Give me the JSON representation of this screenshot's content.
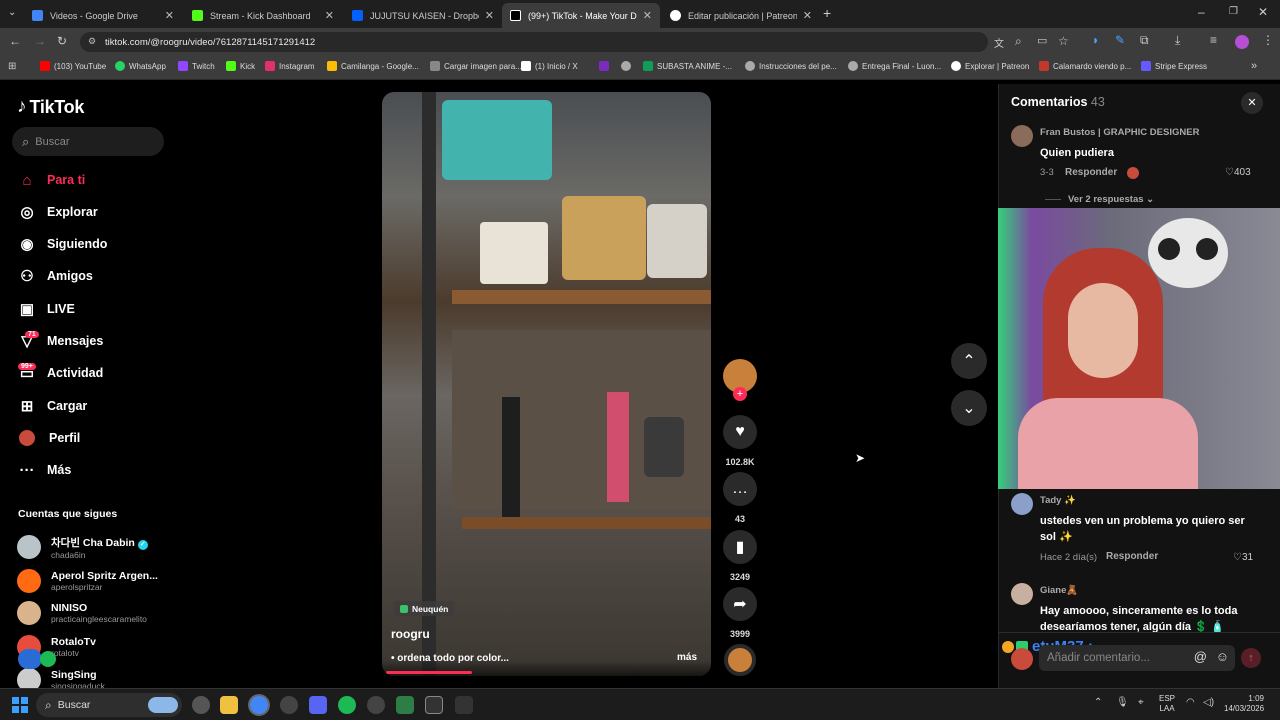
{
  "browser": {
    "tabs": [
      {
        "title": "Videos - Google Drive",
        "color": "#4285f4"
      },
      {
        "title": "Stream - Kick Dashboard",
        "color": "#53fc18"
      },
      {
        "title": "JUJUTSU KAISEN - Dropbox",
        "color": "#0061fe"
      },
      {
        "title": "(99+) TikTok - Make Your Da",
        "color": "#ffffff"
      },
      {
        "title": "Editar publicación | Patreon",
        "color": "#ffffff"
      }
    ],
    "url": "tiktok.com/@roogru/video/7612871145171291412",
    "bookmarks": [
      {
        "label": "(103) YouTube",
        "color": "#ff0000"
      },
      {
        "label": "WhatsApp",
        "color": "#25d366"
      },
      {
        "label": "Twitch",
        "color": "#9146ff"
      },
      {
        "label": "Kick",
        "color": "#53fc18"
      },
      {
        "label": "Instagram",
        "color": "#e1306c"
      },
      {
        "label": "Camilanga - Google...",
        "color": "#fbbc04"
      },
      {
        "label": "Cargar imagen para...",
        "color": "#888888"
      },
      {
        "label": "(1) Inicio / X",
        "color": "#ffffff"
      },
      {
        "label": "",
        "color": "#7b2cbf"
      },
      {
        "label": "",
        "color": "#aaaaaa"
      },
      {
        "label": "SUBASTA ANIME -...",
        "color": "#0f9d58"
      },
      {
        "label": "Instrucciones del pe...",
        "color": "#aaaaaa"
      },
      {
        "label": "Entrega Final - Luon...",
        "color": "#aaaaaa"
      },
      {
        "label": "Explorar | Patreon",
        "color": "#ffffff"
      },
      {
        "label": "Calamardo viendo p...",
        "color": "#c0392b"
      },
      {
        "label": "Stripe Express",
        "color": "#635bff"
      }
    ]
  },
  "tiktok": {
    "logo": "TikTok",
    "search_placeholder": "Buscar",
    "nav": [
      {
        "label": "Para ti",
        "icon": "home-icon"
      },
      {
        "label": "Explorar",
        "icon": "compass-icon"
      },
      {
        "label": "Siguiendo",
        "icon": "following-icon"
      },
      {
        "label": "Amigos",
        "icon": "friends-icon"
      },
      {
        "label": "LIVE",
        "icon": "live-icon"
      },
      {
        "label": "Mensajes",
        "icon": "messages-icon",
        "badge": "71"
      },
      {
        "label": "Actividad",
        "icon": "activity-icon",
        "badge": "99+"
      },
      {
        "label": "Cargar",
        "icon": "upload-icon"
      },
      {
        "label": "Perfil",
        "icon": "profile-icon"
      },
      {
        "label": "Más",
        "icon": "more-icon"
      }
    ],
    "following_title": "Cuentas que sigues",
    "following": [
      {
        "name": "차다빈 Cha Dabin",
        "handle": "chada6in",
        "verified": true,
        "color": "#b8c4c8"
      },
      {
        "name": "Aperol Spritz Argen...",
        "handle": "aperolspritzar",
        "color": "#ff6a13"
      },
      {
        "name": "NINISO",
        "handle": "practicaingleescaramelito",
        "color": "#d9b38c"
      },
      {
        "name": "RotaloTv",
        "handle": "rotalotv",
        "color": "#e74c3c"
      },
      {
        "name": "SingSing",
        "handle": "singsingaduck",
        "color": "#cccccc"
      }
    ]
  },
  "video": {
    "location": "Neuquén",
    "author": "roogru",
    "caption": "• ordena todo por color...",
    "more": "más",
    "likes": "102.8K",
    "comments": "43",
    "saves": "3249",
    "shares": "3999"
  },
  "comments_panel": {
    "title": "Comentarios",
    "count": "43",
    "items": [
      {
        "name": "Fran Bustos | GRAPHIC DESIGNER",
        "text": "Quien pudiera",
        "meta": "3-3",
        "reply": "Responder",
        "likes": "403",
        "replies": "Ver 2 respuestas"
      },
      {
        "name": "Tady ✨",
        "text": "ustedes ven un problema yo quiero ser sol ✨",
        "meta": "Hace 2 día(s)",
        "reply": "Responder",
        "likes": "31"
      },
      {
        "name": "Giane🧸",
        "text": "Hay amoooo, sinceramente es lo toda desearíamos tener, algún día 💲 🧴"
      }
    ],
    "overlay_user": "etuM37 :",
    "input_placeholder": "Añadir comentario..."
  },
  "taskbar": {
    "search": "Buscar",
    "lang1": "ESP",
    "lang2": "LAA",
    "time": "1:09",
    "date": "14/03/2026"
  }
}
